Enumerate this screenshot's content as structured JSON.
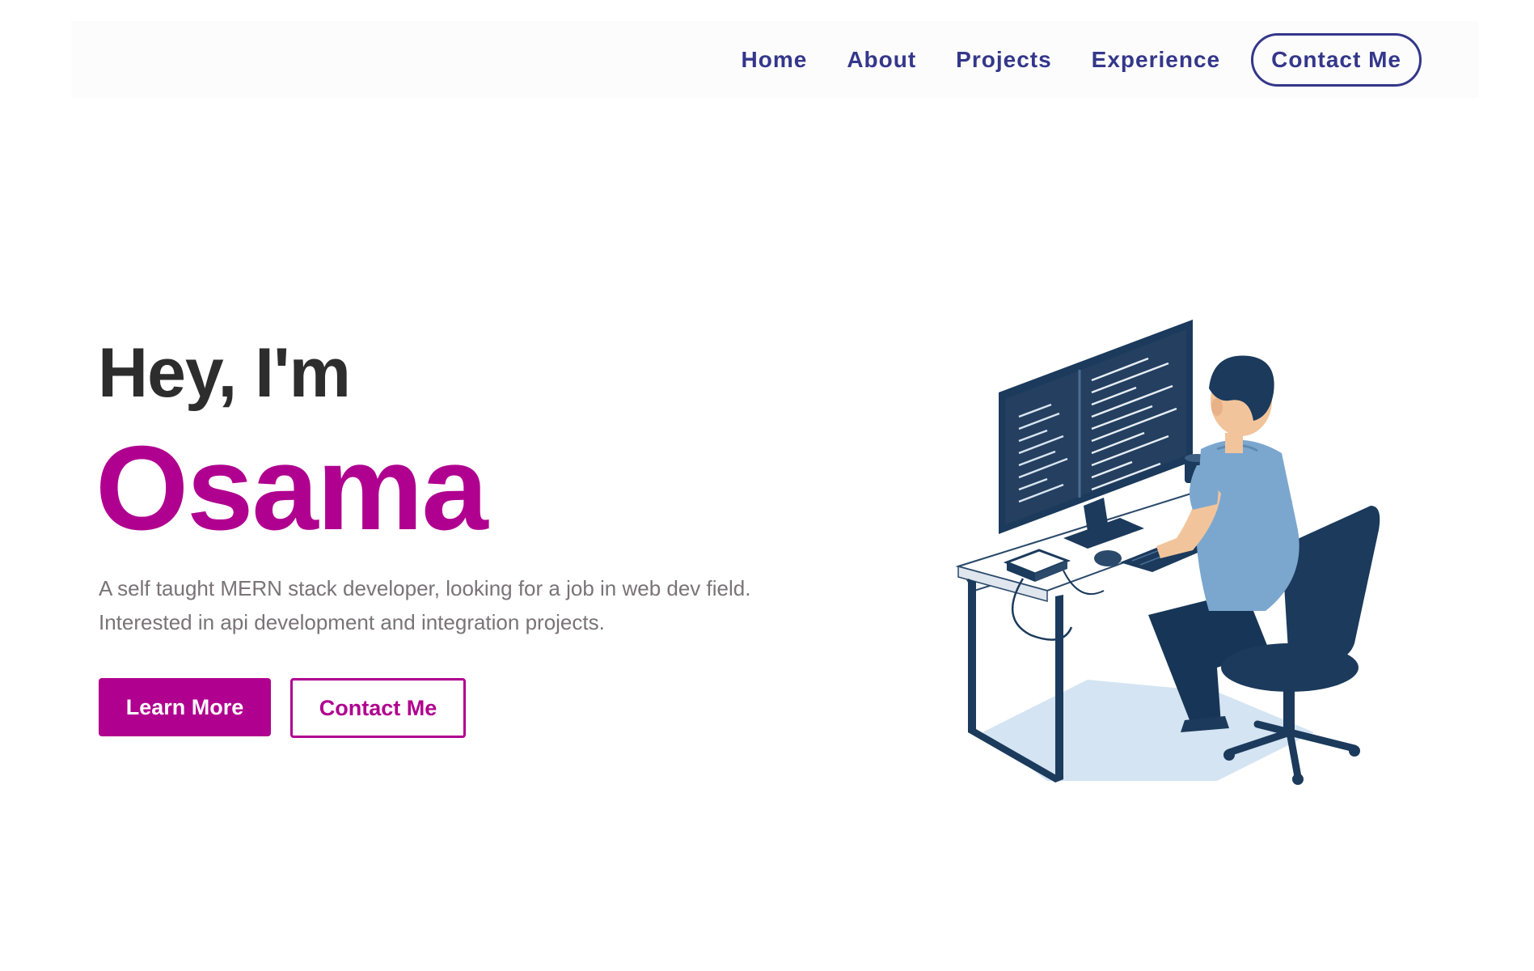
{
  "nav": {
    "links": [
      "Home",
      "About",
      "Projects",
      "Experience"
    ],
    "contact_label": "Contact Me"
  },
  "hero": {
    "greeting": "Hey, I'm",
    "name": "Osama",
    "description_line1": "A self taught MERN stack developer, looking for a job in web dev field.",
    "description_line2": "Interested in api development and integration projects.",
    "primary_button": "Learn More",
    "secondary_button": "Contact Me"
  },
  "illustration": {
    "icon": "developer-at-computer-illustration"
  },
  "colors": {
    "nav_text": "#34378a",
    "accent": "#b0008f",
    "heading": "#2d2d2d",
    "body_text": "#7a7377",
    "illustration_dark": "#1b3a5c",
    "illustration_light": "#7ba7cf"
  }
}
